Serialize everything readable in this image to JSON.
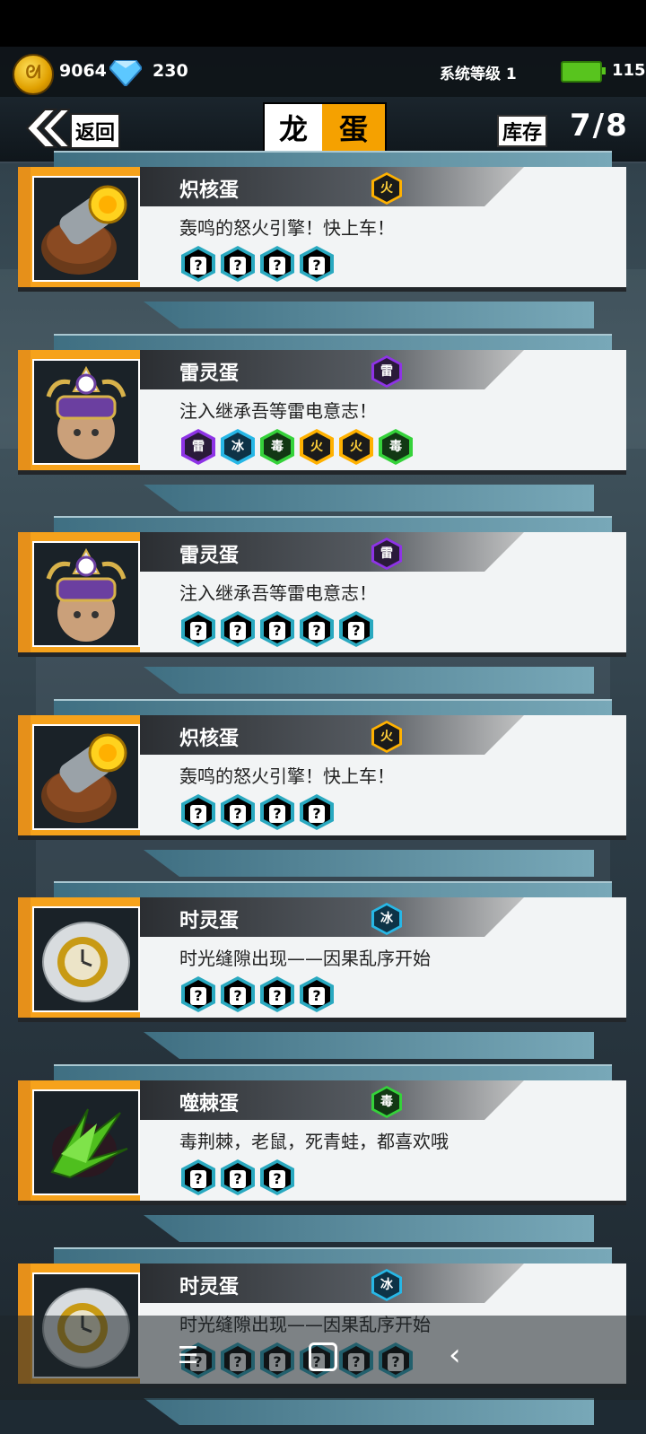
{
  "currency": {
    "coins": "9064",
    "diamonds": "230"
  },
  "system_level": "系统等级 1",
  "energy": "115",
  "header": {
    "back_label": "返回",
    "title_part1": "龙",
    "title_part2": "蛋",
    "stock_label": "库存",
    "stock_value": "7/8"
  },
  "eggs": [
    {
      "name": "炽核蛋",
      "element": "火",
      "element_type": "fire",
      "description": "轰鸣的怒火引擎！快上车！",
      "portrait": "engine-egg",
      "slots": [
        {
          "t": "unknown",
          "l": "?"
        },
        {
          "t": "unknown",
          "l": "?"
        },
        {
          "t": "unknown",
          "l": "?"
        },
        {
          "t": "unknown",
          "l": "?"
        }
      ]
    },
    {
      "name": "雷灵蛋",
      "element": "雷",
      "element_type": "thunder",
      "description": "注入继承吾等雷电意志！",
      "portrait": "samurai-egg",
      "slots": [
        {
          "t": "thunder",
          "l": "雷"
        },
        {
          "t": "ice",
          "l": "冰"
        },
        {
          "t": "poison",
          "l": "毒"
        },
        {
          "t": "fire",
          "l": "火"
        },
        {
          "t": "fire",
          "l": "火"
        },
        {
          "t": "poison",
          "l": "毒"
        }
      ]
    },
    {
      "name": "雷灵蛋",
      "element": "雷",
      "element_type": "thunder",
      "description": "注入继承吾等雷电意志！",
      "portrait": "samurai-egg",
      "slots": [
        {
          "t": "unknown",
          "l": "?"
        },
        {
          "t": "unknown",
          "l": "?"
        },
        {
          "t": "unknown",
          "l": "?"
        },
        {
          "t": "unknown",
          "l": "?"
        },
        {
          "t": "unknown",
          "l": "?"
        }
      ]
    },
    {
      "name": "炽核蛋",
      "element": "火",
      "element_type": "fire",
      "description": "轰鸣的怒火引擎！快上车！",
      "portrait": "engine-egg",
      "slots": [
        {
          "t": "unknown",
          "l": "?"
        },
        {
          "t": "unknown",
          "l": "?"
        },
        {
          "t": "unknown",
          "l": "?"
        },
        {
          "t": "unknown",
          "l": "?"
        }
      ]
    },
    {
      "name": "时灵蛋",
      "element": "冰",
      "element_type": "ice",
      "description": "时光缝隙出现——因果乱序开始",
      "portrait": "clock-egg",
      "slots": [
        {
          "t": "unknown",
          "l": "?"
        },
        {
          "t": "unknown",
          "l": "?"
        },
        {
          "t": "unknown",
          "l": "?"
        },
        {
          "t": "unknown",
          "l": "?"
        }
      ]
    },
    {
      "name": "噬棘蛋",
      "element": "毒",
      "element_type": "poison",
      "description": "毒荆棘，老鼠，死青蛙，都喜欢哦",
      "portrait": "thorn-egg",
      "slots": [
        {
          "t": "unknown",
          "l": "?"
        },
        {
          "t": "unknown",
          "l": "?"
        },
        {
          "t": "unknown",
          "l": "?"
        }
      ]
    },
    {
      "name": "时灵蛋",
      "element": "冰",
      "element_type": "ice",
      "description": "时光缝隙出现——因果乱序开始",
      "portrait": "clock-egg",
      "slots": [
        {
          "t": "unknown",
          "l": "?"
        },
        {
          "t": "unknown",
          "l": "?"
        },
        {
          "t": "unknown",
          "l": "?"
        },
        {
          "t": "unknown",
          "l": "?"
        },
        {
          "t": "unknown",
          "l": "?"
        },
        {
          "t": "unknown",
          "l": "?"
        }
      ]
    }
  ],
  "colors": {
    "accent_orange": "#f5a100",
    "card_bg": "#f2f4f5",
    "teal": "#2aa9c0"
  }
}
